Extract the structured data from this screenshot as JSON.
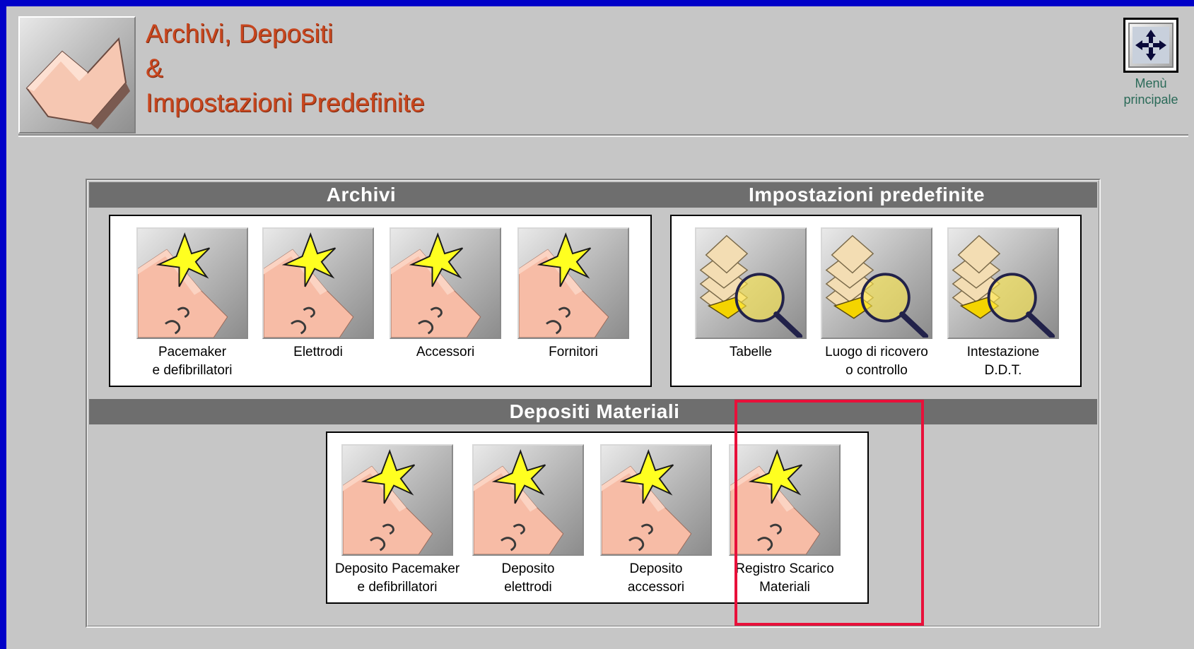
{
  "header": {
    "title_line1": "Archivi, Depositi",
    "title_line2": "&",
    "title_line3": "Impostazioni Predefinite",
    "logo_icon": "folder-icon"
  },
  "main_menu": {
    "label_line1": "Menù",
    "label_line2": "principale",
    "icon": "move-arrows-icon"
  },
  "sections": {
    "archivi": {
      "title": "Archivi",
      "items": [
        {
          "line1": "Pacemaker",
          "line2": "e defibrillatori",
          "icon": "folder-star-icon"
        },
        {
          "line1": "Elettrodi",
          "line2": "",
          "icon": "folder-star-icon"
        },
        {
          "line1": "Accessori",
          "line2": "",
          "icon": "folder-star-icon"
        },
        {
          "line1": "Fornitori",
          "line2": "",
          "icon": "folder-star-icon"
        }
      ]
    },
    "impostazioni": {
      "title": "Impostazioni predefinite",
      "items": [
        {
          "line1": "Tabelle",
          "line2": "",
          "icon": "documents-magnifier-icon"
        },
        {
          "line1": "Luogo di ricovero",
          "line2": "o controllo",
          "icon": "documents-magnifier-icon"
        },
        {
          "line1": "Intestazione",
          "line2": "D.D.T.",
          "icon": "documents-magnifier-icon"
        }
      ]
    },
    "depositi": {
      "title": "Depositi Materiali",
      "items": [
        {
          "line1": "Deposito Pacemaker",
          "line2": "e defibrillatori",
          "icon": "folder-star-icon"
        },
        {
          "line1": "Deposito",
          "line2": "elettrodi",
          "icon": "folder-star-icon"
        },
        {
          "line1": "Deposito",
          "line2": "accessori",
          "icon": "folder-star-icon"
        },
        {
          "line1": "Registro Scarico",
          "line2": "Materiali",
          "icon": "folder-star-icon"
        }
      ]
    }
  },
  "colors": {
    "title": "#c8461e",
    "band": "#6e6e6e",
    "background": "#c6c6c6",
    "frame": "#0000c8",
    "highlight": "#e8103a"
  }
}
